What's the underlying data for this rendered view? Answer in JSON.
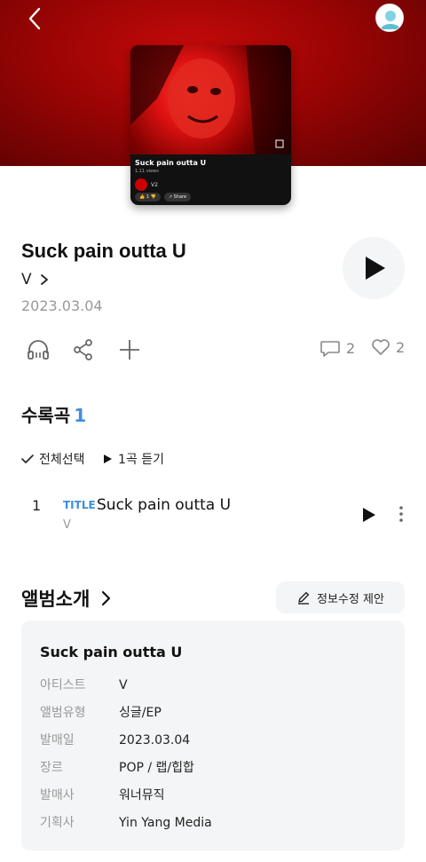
{
  "cover": {
    "video_title": "Suck pain outta U",
    "video_views": "1.11 views",
    "channel": "V2",
    "like_count": "1",
    "share_label": "Share"
  },
  "album": {
    "title": "Suck pain outta U",
    "artist": "V",
    "release_date": "2023.03.04"
  },
  "actions": {
    "comments_count": "2",
    "likes_count": "2"
  },
  "tracklist": {
    "heading": "수록곡",
    "count": "1",
    "select_all": "전체선택",
    "play_n": "1곡 듣기",
    "tracks": [
      {
        "number": "1",
        "badge": "TITLE",
        "title": "Suck pain outta U",
        "artist": "V"
      }
    ]
  },
  "intro": {
    "heading": "앨범소개",
    "suggest_button": "정보수정 제안",
    "box_title": "Suck pain outta U",
    "rows": [
      {
        "key": "아티스트",
        "value": "V"
      },
      {
        "key": "앨범유형",
        "value": "싱글/EP"
      },
      {
        "key": "발매일",
        "value": "2023.03.04"
      },
      {
        "key": "장르",
        "value": "POP / 랩/힙합"
      },
      {
        "key": "발매사",
        "value": "워너뮤직"
      },
      {
        "key": "기획사",
        "value": "Yin Yang Media"
      }
    ]
  },
  "colors": {
    "accent": "#3d8fdc",
    "hero_red": "#9a0404",
    "muted": "#999999"
  }
}
